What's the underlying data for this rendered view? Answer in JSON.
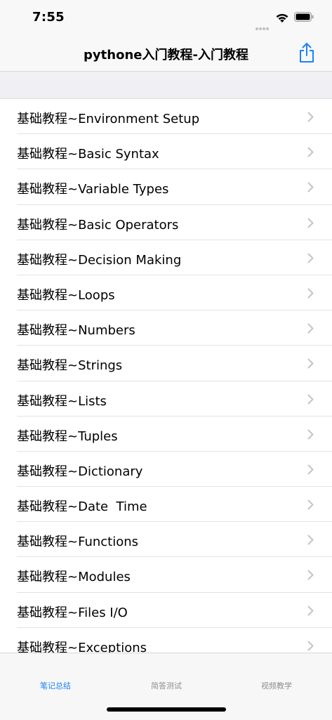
{
  "status_bar": {
    "time": "7:55"
  },
  "nav": {
    "title": "pythone入门教程-入门教程",
    "share_icon": "share-icon"
  },
  "list": {
    "items": [
      "基础教程~Environment Setup",
      "基础教程~Basic Syntax",
      "基础教程~Variable Types",
      "基础教程~Basic Operators",
      "基础教程~Decision Making",
      "基础教程~Loops",
      "基础教程~Numbers",
      "基础教程~Strings",
      "基础教程~Lists",
      "基础教程~Tuples",
      "基础教程~Dictionary",
      "基础教程~Date  Time",
      "基础教程~Functions",
      "基础教程~Modules",
      "基础教程~Files I/O",
      "基础教程~Exceptions"
    ]
  },
  "tabs": [
    {
      "label": "笔记总结",
      "active": true
    },
    {
      "label": "简答测试",
      "active": false
    },
    {
      "label": "视频教学",
      "active": false
    }
  ],
  "colors": {
    "accent": "#1a82fb",
    "inactive": "#8e8e93"
  }
}
